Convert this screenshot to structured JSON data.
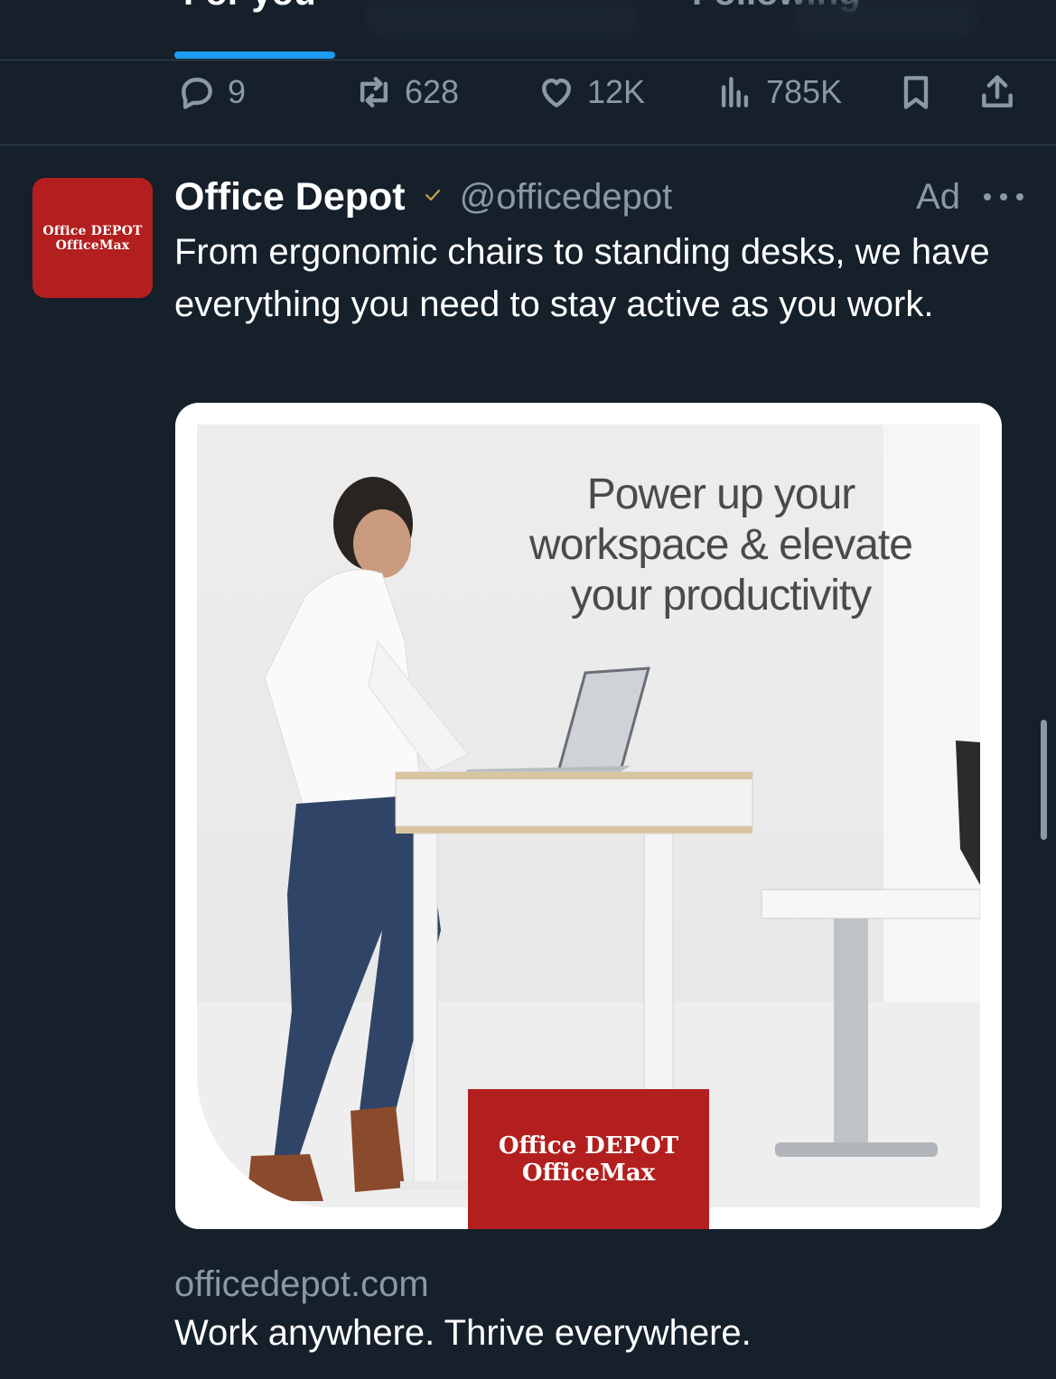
{
  "tabs": {
    "for_you": "For you",
    "following": "Following"
  },
  "actions": {
    "replies": "9",
    "reposts": "628",
    "likes": "12K",
    "views": "785K"
  },
  "post": {
    "avatar_line1": "Office DEPOT",
    "avatar_line2": "OfficeMax",
    "name": "Office Depot",
    "handle": "@officedepot",
    "ad_label": "Ad",
    "text": "From ergonomic chairs to standing desks, we have everything you need to stay active as you work.",
    "media": {
      "headline": "Power up your workspace & elevate your productivity",
      "brand_line1": "Office DEPOT",
      "brand_line2": "OfficeMax"
    },
    "link_domain": "officedepot.com",
    "link_title": "Work anywhere. Thrive everywhere."
  },
  "colors": {
    "background": "#15202b",
    "accent": "#1d9bf0",
    "muted": "#8b98a5",
    "brand_red": "#b31f1f"
  }
}
